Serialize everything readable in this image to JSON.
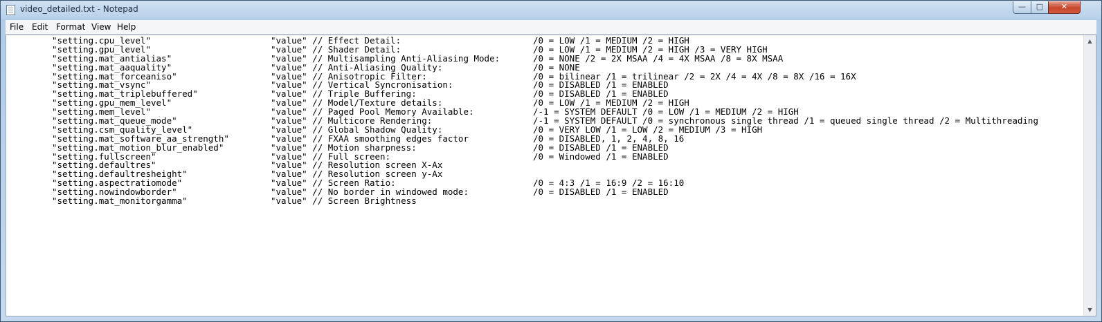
{
  "window": {
    "title": "video_detailed.txt - Notepad",
    "controls": {
      "minimize": "—",
      "maximize": "□",
      "close": "✕"
    }
  },
  "menu": [
    "File",
    "Edit",
    "Format",
    "View",
    "Help"
  ],
  "document": {
    "lines": [
      {
        "key": "\"setting.cpu_level\"",
        "value": "\"value\" // Effect Detail:",
        "options": "/0 = LOW /1 = MEDIUM /2 = HIGH"
      },
      {
        "key": "\"setting.gpu_level\"",
        "value": "\"value\" // Shader Detail:",
        "options": "/0 = LOW /1 = MEDIUM /2 = HIGH /3 = VERY HIGH"
      },
      {
        "key": "\"setting.mat_antialias\"",
        "value": "\"value\" // Multisampling Anti-Aliasing Mode:",
        "options": "/0 = NONE /2 = 2X MSAA /4 = 4X MSAA /8 = 8X MSAA"
      },
      {
        "key": "\"setting.mat_aaquality\"",
        "value": "\"value\" // Anti-Aliasing Quality:",
        "options": "/0 = NONE"
      },
      {
        "key": "\"setting.mat_forceaniso\"",
        "value": "\"value\" // Anisotropic Filter:",
        "options": "/0 = bilinear /1 = trilinear /2 = 2X /4 = 4X /8 = 8X /16 = 16X"
      },
      {
        "key": "\"setting.mat_vsync\"",
        "value": "\"value\" // Vertical Syncronisation:",
        "options": "/0 = DISABLED /1 = ENABLED"
      },
      {
        "key": "\"setting.mat_triplebuffered\"",
        "value": "\"value\" // Triple Buffering:",
        "options": "/0 = DISABLED /1 = ENABLED"
      },
      {
        "key": "\"setting.gpu_mem_level\"",
        "value": "\"value\" // Model/Texture details:",
        "options": "/0 = LOW /1 = MEDIUM /2 = HIGH"
      },
      {
        "key": "\"setting.mem_level\"",
        "value": "\"value\" // Paged Pool Memory Available:",
        "options": "/-1 = SYSTEM DEFAULT /0 = LOW /1 = MEDIUM /2 = HIGH"
      },
      {
        "key": "\"setting.mat_queue_mode\"",
        "value": "\"value\" // Multicore Rendering:",
        "options": "/-1 = SYSTEM DEFAULT /0 = synchronous single thread /1 = queued single thread /2 = Multithreading"
      },
      {
        "key": "\"setting.csm_quality_level\"",
        "value": "\"value\" // Global Shadow Quality:",
        "options": "/0 = VERY LOW /1 = LOW /2 = MEDIUM /3 = HIGH"
      },
      {
        "key": "\"setting.mat_software_aa_strength\"",
        "value": "\"value\" // FXAA smoothing edges factor",
        "options": "/0 = DISABLED, 1, 2, 4, 8, 16"
      },
      {
        "key": "\"setting.mat_motion_blur_enabled\"",
        "value": "\"value\" // Motion sharpness:",
        "options": "/0 = DISABLED /1 = ENABLED"
      },
      {
        "key": "\"setting.fullscreen\"",
        "value": "\"value\" // Full screen:",
        "options": "/0 = Windowed /1 = ENABLED"
      },
      {
        "key": "\"setting.defaultres\"",
        "value": "\"value\" // Resolution screen X-Ax",
        "options": ""
      },
      {
        "key": "\"setting.defaultresheight\"",
        "value": "\"value\" // Resolution screen y-Ax",
        "options": ""
      },
      {
        "key": "\"setting.aspectratiomode\"",
        "value": "\"value\" // Screen Ratio:",
        "options": "/0 = 4:3 /1 = 16:9 /2 = 16:10"
      },
      {
        "key": "\"setting.nowindowborder\"",
        "value": "\"value\" // No border in windowed mode:",
        "options": "/0 = DISABLED /1 = ENABLED"
      },
      {
        "key": "\"setting.mat_monitorgamma\"",
        "value": "\"value\" // Screen Brightness",
        "options": ""
      }
    ]
  },
  "scrollbar": {
    "up": "▲",
    "down": "▼"
  }
}
